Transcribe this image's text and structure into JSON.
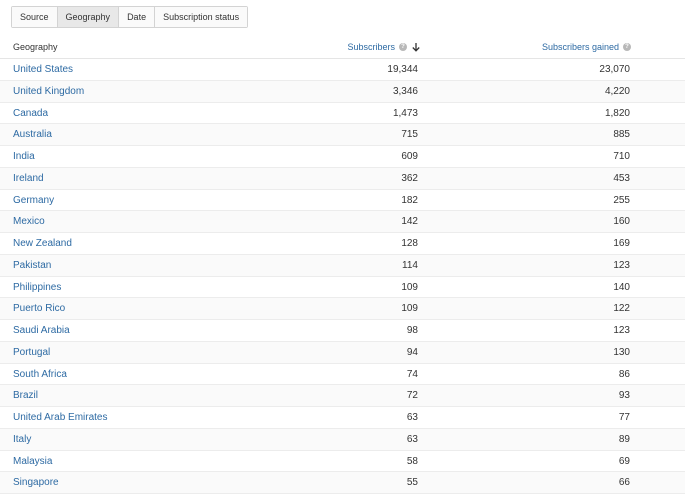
{
  "tabs": [
    {
      "label": "Source",
      "active": false
    },
    {
      "label": "Geography",
      "active": true
    },
    {
      "label": "Date",
      "active": false
    },
    {
      "label": "Subscription status",
      "active": false
    }
  ],
  "columns": {
    "geography": "Geography",
    "subscribers": "Subscribers",
    "subscribers_gained": "Subscribers gained",
    "help_glyph": "?",
    "sort_icon": "arrow-down-icon"
  },
  "rows": [
    {
      "geo": "United States",
      "subs": "19,344",
      "gained": "23,070"
    },
    {
      "geo": "United Kingdom",
      "subs": "3,346",
      "gained": "4,220"
    },
    {
      "geo": "Canada",
      "subs": "1,473",
      "gained": "1,820"
    },
    {
      "geo": "Australia",
      "subs": "715",
      "gained": "885"
    },
    {
      "geo": "India",
      "subs": "609",
      "gained": "710"
    },
    {
      "geo": "Ireland",
      "subs": "362",
      "gained": "453"
    },
    {
      "geo": "Germany",
      "subs": "182",
      "gained": "255"
    },
    {
      "geo": "Mexico",
      "subs": "142",
      "gained": "160"
    },
    {
      "geo": "New Zealand",
      "subs": "128",
      "gained": "169"
    },
    {
      "geo": "Pakistan",
      "subs": "114",
      "gained": "123"
    },
    {
      "geo": "Philippines",
      "subs": "109",
      "gained": "140"
    },
    {
      "geo": "Puerto Rico",
      "subs": "109",
      "gained": "122"
    },
    {
      "geo": "Saudi Arabia",
      "subs": "98",
      "gained": "123"
    },
    {
      "geo": "Portugal",
      "subs": "94",
      "gained": "130"
    },
    {
      "geo": "South Africa",
      "subs": "74",
      "gained": "86"
    },
    {
      "geo": "Brazil",
      "subs": "72",
      "gained": "93"
    },
    {
      "geo": "United Arab Emirates",
      "subs": "63",
      "gained": "77"
    },
    {
      "geo": "Italy",
      "subs": "63",
      "gained": "89"
    },
    {
      "geo": "Malaysia",
      "subs": "58",
      "gained": "69"
    },
    {
      "geo": "Singapore",
      "subs": "55",
      "gained": "66"
    }
  ],
  "colors": {
    "link": "#2d6aa3",
    "text": "#333333",
    "border": "#d3d3d3",
    "active_tab": "#e8e8e8"
  }
}
